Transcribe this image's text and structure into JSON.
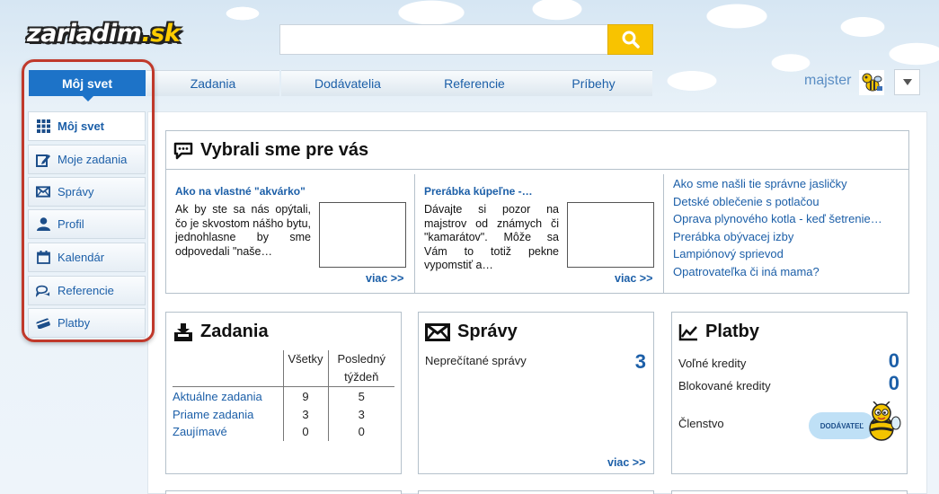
{
  "logo": {
    "name": "zariadim",
    "tld": ".sk"
  },
  "search": {
    "value": "",
    "placeholder": ""
  },
  "nav": {
    "active": "Môj svet",
    "tabs": [
      "Zadania",
      "Dodávatelia",
      "Referencie",
      "Príbehy"
    ]
  },
  "user": {
    "name": "majster"
  },
  "sidebar": {
    "items": [
      {
        "label": "Môj svet",
        "icon": "grid-icon"
      },
      {
        "label": "Moje zadania",
        "icon": "edit-icon"
      },
      {
        "label": "Správy",
        "icon": "envelope-icon"
      },
      {
        "label": "Profil",
        "icon": "user-icon"
      },
      {
        "label": "Kalendár",
        "icon": "calendar-icon"
      },
      {
        "label": "Referencie",
        "icon": "chat-icon"
      },
      {
        "label": "Platby",
        "icon": "card-icon"
      }
    ]
  },
  "featured": {
    "title": "Vybrali sme pre vás",
    "articles": [
      {
        "title": "Ako na vlastné \"akvárko\"",
        "text": "Ak by ste sa nás opýtali, čo je skvostom nášho bytu, jednohlasne by sme odpovedali \"naše…",
        "more": "viac >>"
      },
      {
        "title": "Prerábka kúpeľne -…",
        "text": "Dávajte si pozor na majstrov od známych či \"kamarátov\". Môže sa Vám to totiž pekne vypomstiť a…",
        "more": "viac >>"
      }
    ],
    "links": [
      "Ako sme našli tie správne jasličky",
      "Detské oblečenie s potlačou",
      "Oprava plynového kotla - keď šetrenie…",
      "Prerábka obývacej izby",
      "Lampiónový sprievod",
      "Opatrovateľka či iná mama?"
    ]
  },
  "zadania": {
    "title": "Zadania",
    "col_all": "Všetky",
    "col_week": "Posledný týždeň",
    "rows": [
      {
        "label": "Aktuálne zadania",
        "all": "9",
        "week": "5"
      },
      {
        "label": "Priame zadania",
        "all": "3",
        "week": "3"
      },
      {
        "label": "Zaujímavé",
        "all": "0",
        "week": "0"
      }
    ]
  },
  "spravy": {
    "title": "Správy",
    "unread_label": "Neprečítané správy",
    "unread_count": "3",
    "more": "viac >>"
  },
  "platby": {
    "title": "Platby",
    "free_label": "Voľné kredity",
    "free_value": "0",
    "blocked_label": "Blokované kredity",
    "blocked_value": "0",
    "membership_label": "Členstvo",
    "membership_badge": "DODÁVATEĽ"
  },
  "colors": {
    "accent": "#1d73c8",
    "link": "#1c5fa8",
    "search_button": "#f8c300",
    "highlight_frame": "#c0392b"
  }
}
